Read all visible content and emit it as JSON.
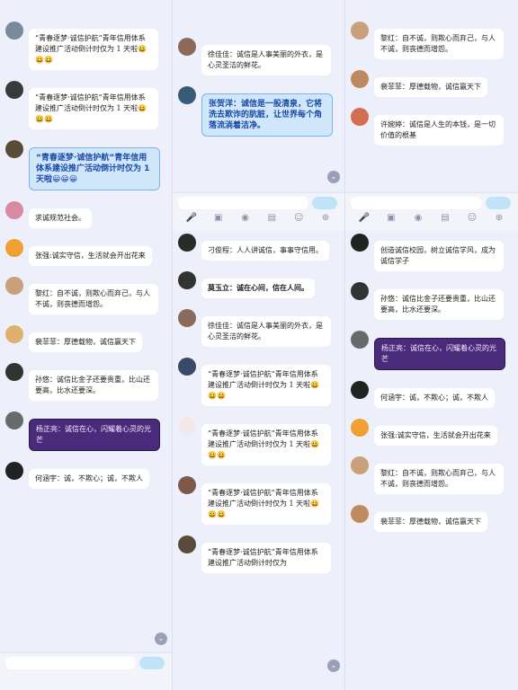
{
  "colors": {
    "accent": "#8f9bd6",
    "bubble": "#ffffff",
    "highlight_blue": "#cfe6fb",
    "purple": "#4a2a7a"
  },
  "composer": {
    "send_label": ""
  },
  "left": {
    "messages": [
      {
        "meta": "",
        "text": "“青春逐梦·诚信护航”青年信用体系建设推广活动倒计时仅为 1 天啦😀😀😀",
        "style": "plain",
        "avatar": "#7a8a9a"
      },
      {
        "meta": "",
        "text": "“青春逐梦·诚信护航”青年信用体系建设推广活动倒计时仅为 1 天啦😀😀😀",
        "style": "plain",
        "avatar": "#3a3a3a"
      },
      {
        "meta": "",
        "text": "“青春逐梦·诚信护航”青年信用体系建设推广活动倒计时仅为 1 天啦😀😀😀",
        "style": "blue",
        "avatar": "#5a4a3a"
      },
      {
        "meta": "",
        "text": "求诚规范社会。",
        "style": "plain",
        "avatar": "#d88aa0"
      },
      {
        "meta": "",
        "text": "张强:诚实守信，生活就会开出花来",
        "style": "plain",
        "avatar": "#f0a030"
      },
      {
        "meta": "",
        "text": "黎红：自不诚，则欺心而弃己，与人不诚，则丧德而增怨。",
        "style": "plain",
        "avatar": "#c9a07a"
      },
      {
        "meta": "",
        "text": "裴菲菲：厚德载物，诚信赢天下",
        "style": "plain",
        "avatar": "#e0b070"
      },
      {
        "meta": "",
        "text": "孙悠：诚信比金子还要贵重，比山还要高，比水还要深。",
        "style": "plain",
        "avatar": "#333333"
      },
      {
        "meta": "",
        "text": "杨正亮：诚信在心，闪耀着心灵的光芒",
        "style": "purple",
        "avatar": "#6a6a6a"
      },
      {
        "meta": "",
        "text": "何涵宇：诚，不欺心；诚，不欺人",
        "style": "plain",
        "avatar": "#222222"
      }
    ],
    "notes": [
      {
        "after": 1,
        "text": "",
        "kind": "time"
      },
      {
        "after": 4,
        "text": "",
        "kind": "time"
      },
      {
        "after": 5,
        "text": "",
        "kind": "time"
      }
    ]
  },
  "mid": {
    "messages": [
      {
        "meta": "",
        "text": "徐佳佳：诚信是人事美丽的外衣，是心灵圣洁的鲜花。",
        "style": "plain",
        "avatar": "#8a6a5a"
      },
      {
        "meta": "",
        "text": "张贺洋：诚信是一股清泉，它将洗去欺诈的肮脏，让世界每个角落流淌着洁净。",
        "style": "blue",
        "avatar": "#3a5a7a"
      },
      {
        "meta": "",
        "text": "刁俊程：人人讲诚信，事事守信用。",
        "style": "plain",
        "avatar": "#2a2a2a"
      },
      {
        "meta": "",
        "text": "莫玉立：诚在心间，信在人间。",
        "style": "plainbold",
        "avatar": "#333333"
      },
      {
        "meta": "",
        "text": "徐佳佳：诚信是人事美丽的外衣，是心灵圣洁的鲜花。",
        "style": "plain",
        "avatar": "#8a6a5a"
      },
      {
        "meta": "",
        "text": "“青春逐梦·诚信护航”青年信用体系建设推广活动倒计时仅为 1 天啦😀😀😀",
        "style": "plain",
        "avatar": "#3a4a6a"
      },
      {
        "meta": "",
        "text": "“青春逐梦·诚信护航”青年信用体系建设推广活动倒计时仅为 1 天啦😀😀😀",
        "style": "plain",
        "avatar": "#f3e8e8"
      },
      {
        "meta": "",
        "text": "“青春逐梦·诚信护航”青年信用体系建设推广活动倒计时仅为 1 天啦😀😀😀",
        "style": "plain",
        "avatar": "#7a5a4a"
      },
      {
        "meta": "",
        "text": "“青春逐梦·诚信护航”青年信用体系建设推广活动倒计时仅为",
        "style": "plain",
        "avatar": "#5a4a3a"
      }
    ]
  },
  "right": {
    "messages": [
      {
        "meta": "",
        "text": "黎红：自不诚，则欺心而弃己，与人不诚，则丧德而增怨。",
        "style": "plain",
        "avatar": "#c9a07a"
      },
      {
        "meta": "",
        "text": "裴菲菲：厚德载物，诚信赢天下",
        "style": "plain",
        "avatar": "#c08a60"
      },
      {
        "meta": "",
        "text": "许婉婷：诚信是人生的本钱，是一切价值的根基",
        "style": "plain",
        "avatar": "#d07050"
      },
      {
        "meta": "",
        "text": "创造诚信校园，树立诚信学风，成为诚信学子",
        "style": "plain",
        "avatar": "#222222"
      },
      {
        "meta": "",
        "text": "孙悠：诚信比金子还要贵重，比山还要高，比水还要深。",
        "style": "plain",
        "avatar": "#333333"
      },
      {
        "meta": "",
        "text": "杨正亮：诚信在心，闪耀着心灵的光芒",
        "style": "purple",
        "avatar": "#6a6a6a"
      },
      {
        "meta": "",
        "text": "何涵宇：诚，不欺心；诚，不欺人",
        "style": "plain",
        "avatar": "#222222"
      },
      {
        "meta": "",
        "text": "张强:诚实守信，生活就会开出花来",
        "style": "plain",
        "avatar": "#f0a030"
      },
      {
        "meta": "",
        "text": "黎红：自不诚，则欺心而弃己，与人不诚，则丧德而增怨。",
        "style": "plain",
        "avatar": "#c9a07a"
      },
      {
        "meta": "",
        "text": "裴菲菲：厚德载物，诚信赢天下",
        "style": "plain",
        "avatar": "#c08a60"
      }
    ]
  },
  "toolbar_icons": [
    "mic-icon",
    "image-icon",
    "camera-icon",
    "gift-icon",
    "emoji-icon",
    "plus-icon"
  ]
}
